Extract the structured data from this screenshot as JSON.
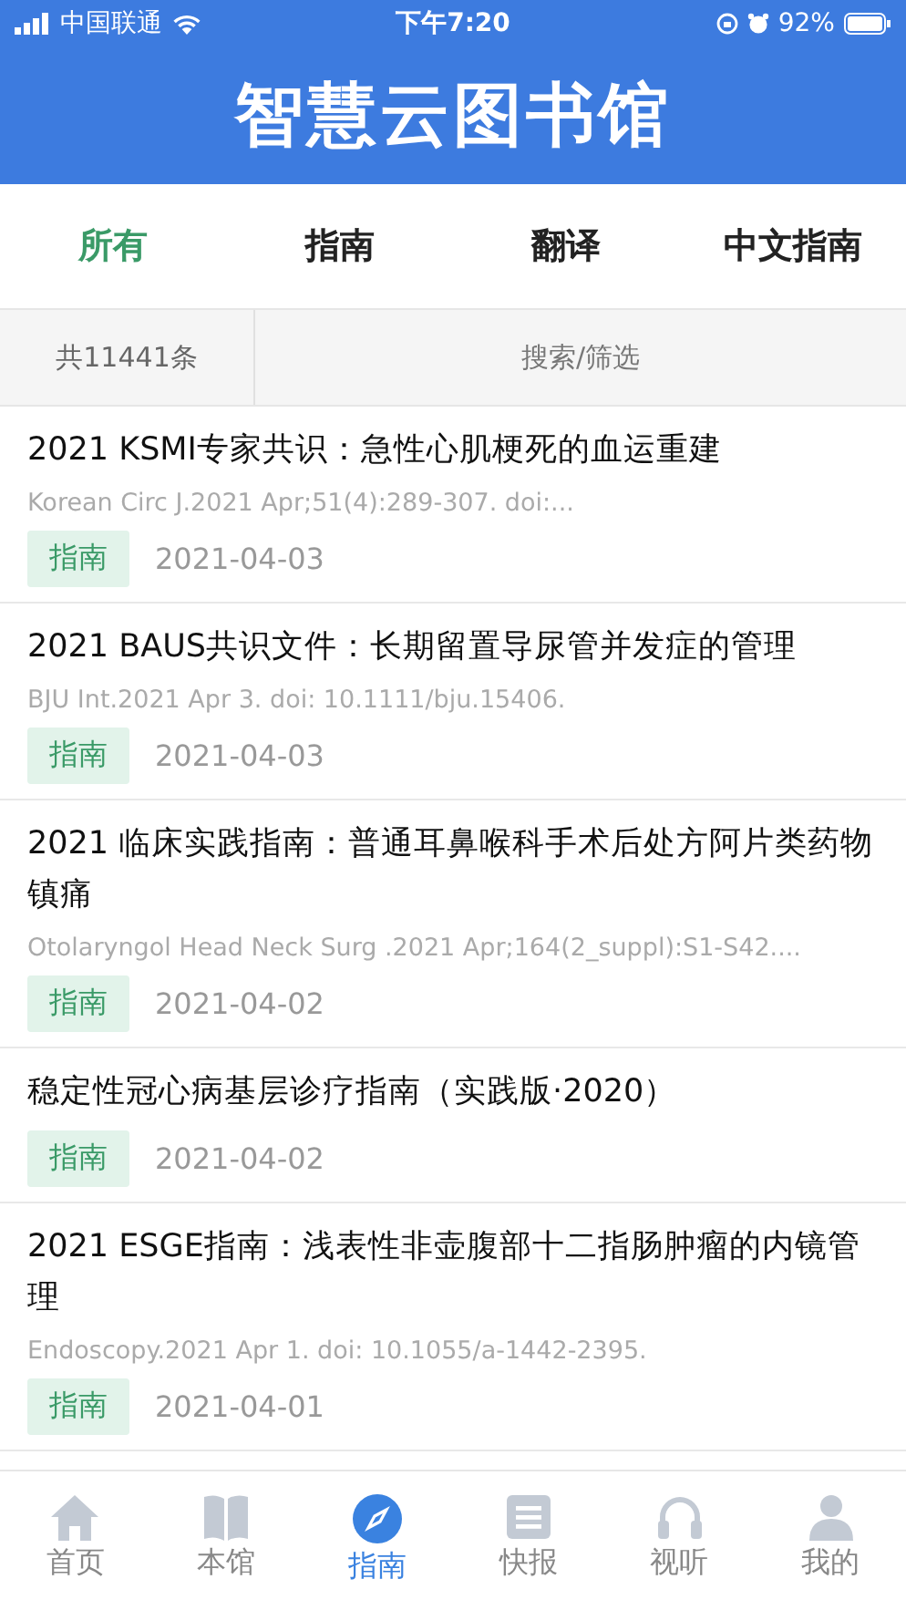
{
  "status_bar": {
    "carrier": "中国联通",
    "time": "下午7:20",
    "battery": "92%"
  },
  "header": {
    "title": "智慧云图书馆"
  },
  "filter_tabs": [
    {
      "label": "所有",
      "selected": true
    },
    {
      "label": "指南",
      "selected": false
    },
    {
      "label": "翻译",
      "selected": false
    },
    {
      "label": "中文指南",
      "selected": false
    }
  ],
  "toolbar": {
    "count": "共11441条",
    "search": "搜索/筛选"
  },
  "articles": [
    {
      "title": "2021 KSMI专家共识：急性心肌梗死的血运重建",
      "source": "Korean Circ J.2021 Apr;51(4):289-307. doi:...",
      "tag": "指南",
      "date": "2021-04-03"
    },
    {
      "title": "2021 BAUS共识文件：长期留置导尿管并发症的管理",
      "source": "BJU Int.2021 Apr 3. doi: 10.1111/bju.15406.",
      "tag": "指南",
      "date": "2021-04-03"
    },
    {
      "title": "2021 临床实践指南：普通耳鼻喉科手术后处方阿片类药物镇痛",
      "source": "Otolaryngol Head Neck Surg .2021 Apr;164(2_suppl):S1-S42....",
      "tag": "指南",
      "date": "2021-04-02"
    },
    {
      "title": "稳定性冠心病基层诊疗指南（实践版·2020）",
      "tag": "指南",
      "date": "2021-04-02"
    },
    {
      "title": "2021 ESGE指南：浅表性非壶腹部十二指肠肿瘤的内镜管理",
      "source": "Endoscopy.2021 Apr 1. doi: 10.1055/a-1442-2395.",
      "tag": "指南",
      "date": "2021-04-01"
    }
  ],
  "tab_bar": [
    {
      "label": "首页",
      "kind": "home",
      "selected": false
    },
    {
      "label": "本馆",
      "kind": "book",
      "selected": false
    },
    {
      "label": "指南",
      "kind": "compass",
      "selected": true
    },
    {
      "label": "快报",
      "kind": "list",
      "selected": false
    },
    {
      "label": "视听",
      "kind": "headphones",
      "selected": false
    },
    {
      "label": "我的",
      "kind": "person",
      "selected": false
    }
  ]
}
